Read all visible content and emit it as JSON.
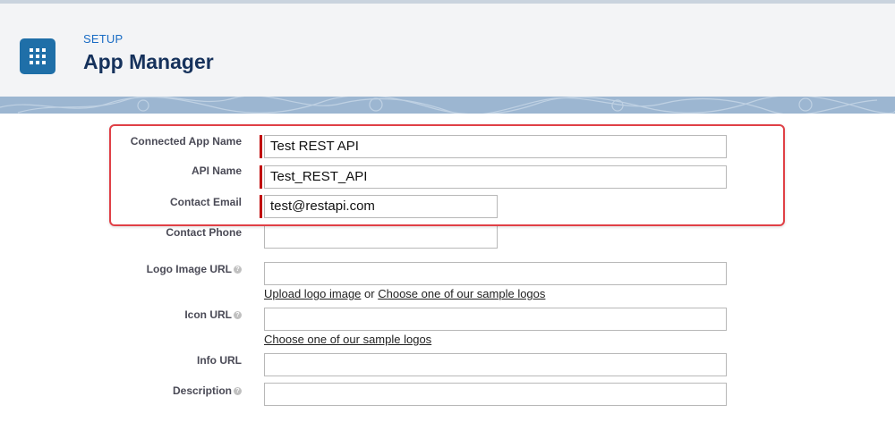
{
  "header": {
    "setup_label": "SETUP",
    "title": "App Manager",
    "app_icon": "app-launcher-grid-icon"
  },
  "form": {
    "connected_app_name": {
      "label": "Connected App Name",
      "value": "Test REST API",
      "required": true
    },
    "api_name": {
      "label": "API Name",
      "value": "Test_REST_API",
      "required": true
    },
    "contact_email": {
      "label": "Contact Email",
      "value": "test@restapi.com",
      "required": true
    },
    "contact_phone": {
      "label": "Contact Phone",
      "value": ""
    },
    "logo_image_url": {
      "label": "Logo Image URL",
      "value": "",
      "upload_link": "Upload logo image",
      "or_text": "or",
      "sample_link": "Choose one of our sample logos"
    },
    "icon_url": {
      "label": "Icon URL",
      "value": "",
      "sample_link": "Choose one of our sample logos"
    },
    "info_url": {
      "label": "Info URL",
      "value": ""
    },
    "description": {
      "label": "Description",
      "value": ""
    }
  },
  "colors": {
    "accent": "#1f6fa8",
    "required": "#c00000",
    "highlight": "#e04046"
  }
}
